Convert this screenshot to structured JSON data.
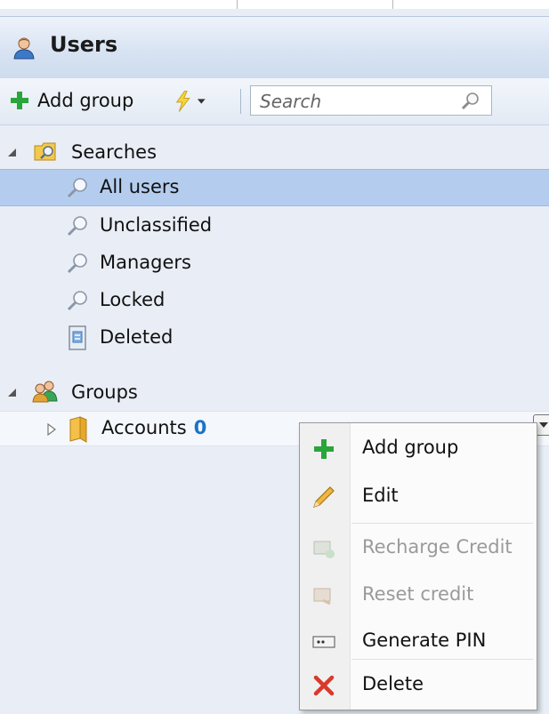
{
  "panel": {
    "title": "Users",
    "icon": "users-icon"
  },
  "toolbar": {
    "add_group_label": "Add group",
    "actions_icon": "lightning-icon",
    "search_placeholder": "Search"
  },
  "tree": {
    "searches": {
      "label": "Searches",
      "items": [
        {
          "label": "All users",
          "icon": "magnifier-icon",
          "selected": true
        },
        {
          "label": "Unclassified",
          "icon": "magnifier-icon"
        },
        {
          "label": "Managers",
          "icon": "magnifier-icon"
        },
        {
          "label": "Locked",
          "icon": "magnifier-icon"
        },
        {
          "label": "Deleted",
          "icon": "recycle-bin-icon"
        }
      ]
    },
    "groups": {
      "label": "Groups",
      "items": [
        {
          "label": "Accounts",
          "count": "0"
        }
      ]
    }
  },
  "context_menu": {
    "items": [
      {
        "label": "Add group",
        "icon": "plus-icon",
        "enabled": true
      },
      {
        "label": "Edit",
        "icon": "pencil-icon",
        "enabled": true
      },
      {
        "label": "Recharge Credit",
        "icon": "recharge-icon",
        "enabled": false
      },
      {
        "label": "Reset credit",
        "icon": "reset-icon",
        "enabled": false
      },
      {
        "label": "Generate PIN",
        "icon": "pin-icon",
        "enabled": true
      },
      {
        "label": "Delete",
        "icon": "delete-icon",
        "enabled": true
      }
    ]
  },
  "colors": {
    "selection": "#b4cdee",
    "count": "#1a73c9",
    "accent_green": "#2aa53a"
  }
}
